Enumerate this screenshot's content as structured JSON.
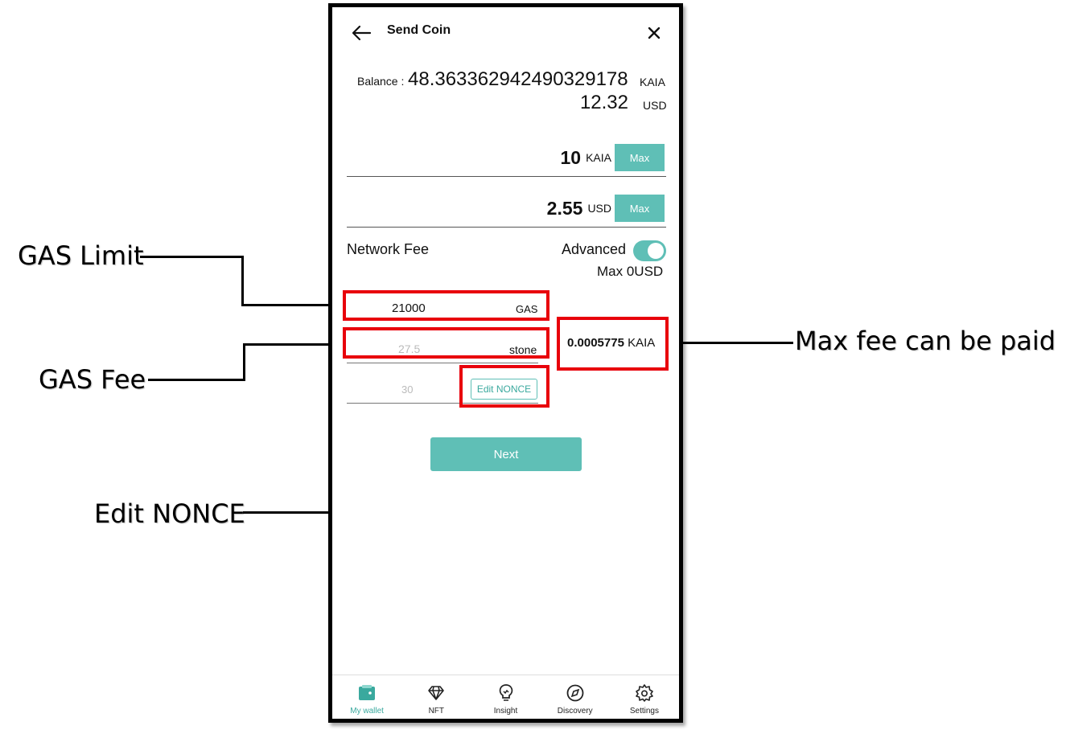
{
  "header": {
    "title": "Send Coin"
  },
  "balance": {
    "label": "Balance :",
    "value": "48.363362942490329178",
    "unit": "KAIA",
    "usd_value": "12.32",
    "usd_unit": "USD"
  },
  "amount_kaia": {
    "value": "10",
    "unit": "KAIA",
    "max_label": "Max"
  },
  "amount_usd": {
    "value": "2.55",
    "unit": "USD",
    "max_label": "Max"
  },
  "network_fee": {
    "label": "Network Fee",
    "advanced_label": "Advanced",
    "advanced_on": true,
    "max_usd": "Max 0USD"
  },
  "gas_limit": {
    "value": "21000",
    "unit": "GAS"
  },
  "gas_fee": {
    "value": "27.5",
    "unit": "stone"
  },
  "nonce": {
    "value": "30",
    "edit_label": "Edit NONCE"
  },
  "max_fee": {
    "value": "0.0005775",
    "unit": "KAIA"
  },
  "next_label": "Next",
  "nav": [
    {
      "label": "My wallet",
      "icon": "wallet-icon",
      "active": true
    },
    {
      "label": "NFT",
      "icon": "diamond-icon",
      "active": false
    },
    {
      "label": "Insight",
      "icon": "lightbulb-icon",
      "active": false
    },
    {
      "label": "Discovery",
      "icon": "compass-icon",
      "active": false
    },
    {
      "label": "Settings",
      "icon": "gear-icon",
      "active": false
    }
  ],
  "annotations": {
    "gas_limit": "GAS Limit",
    "gas_fee": "GAS Fee",
    "edit_nonce": "Edit NONCE",
    "max_fee": "Max fee can be paid"
  },
  "colors": {
    "accent": "#5fbfb6",
    "highlight": "#e8000b"
  }
}
